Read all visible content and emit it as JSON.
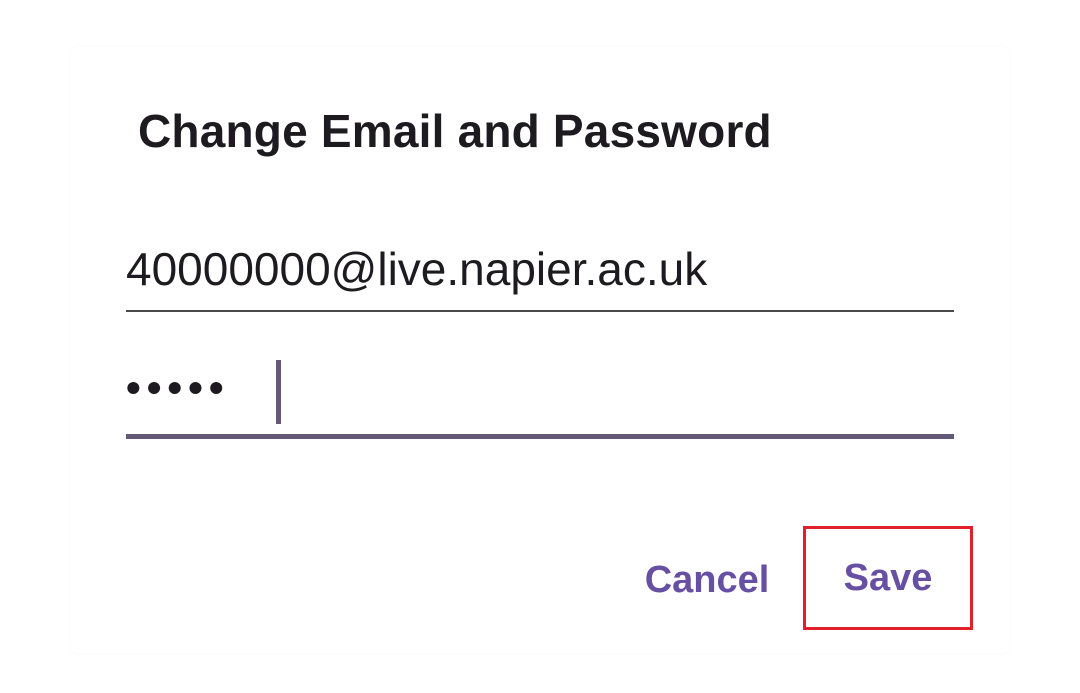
{
  "dialog": {
    "title": "Change Email and Password",
    "email_field": {
      "value": "40000000@live.napier.ac.uk"
    },
    "password_field": {
      "value": "•••••"
    },
    "buttons": {
      "cancel_label": "Cancel",
      "save_label": "Save"
    }
  },
  "colors": {
    "accent": "#6750a4",
    "highlight_border": "#e0202a",
    "active_underline": "#645a78"
  }
}
